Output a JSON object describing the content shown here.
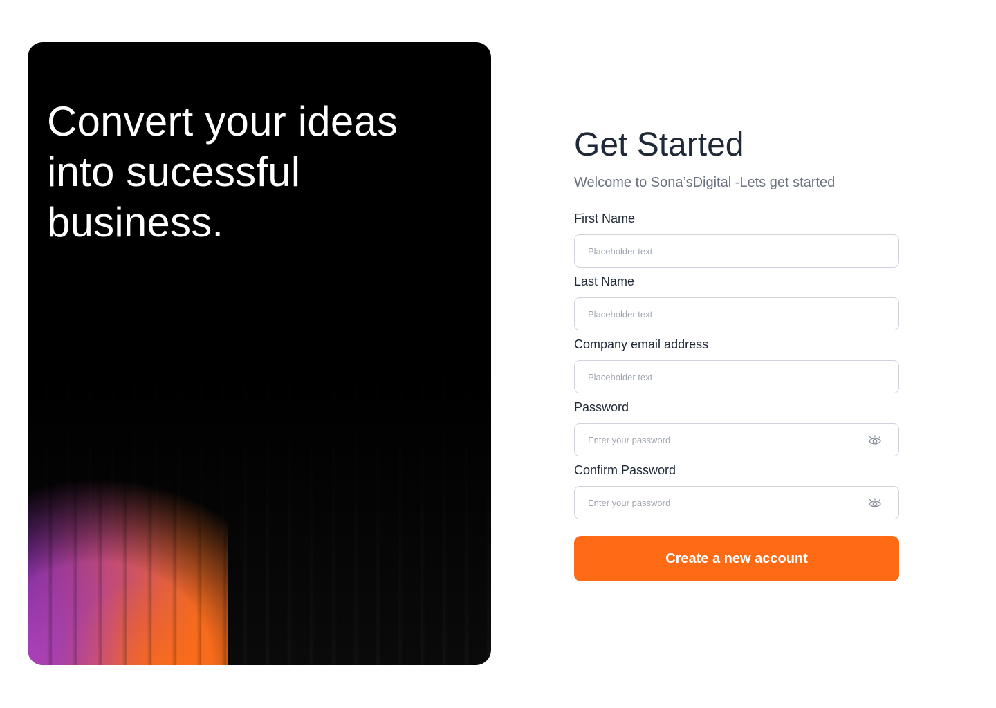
{
  "hero": {
    "title": "Convert your ideas into sucessful business."
  },
  "form": {
    "title": "Get Started",
    "subtitle": "Welcome to Sona’sDigital -Lets get started",
    "fields": [
      {
        "label": "First Name",
        "placeholder": "Placeholder text"
      },
      {
        "label": "Last Name",
        "placeholder": "Placeholder text"
      },
      {
        "label": "Company email address",
        "placeholder": "Placeholder text"
      },
      {
        "label": "Password",
        "placeholder": "Enter your password",
        "icon": "eye-icon"
      },
      {
        "label": "Confirm Password",
        "placeholder": "Enter your password",
        "icon": "eye-icon"
      }
    ],
    "submit_label": "Create a new account"
  },
  "colors": {
    "accent": "#ff6a14",
    "heading": "#1f2937",
    "muted": "#6b7280",
    "border": "#cfd4dc",
    "hero_bg": "#000000"
  }
}
